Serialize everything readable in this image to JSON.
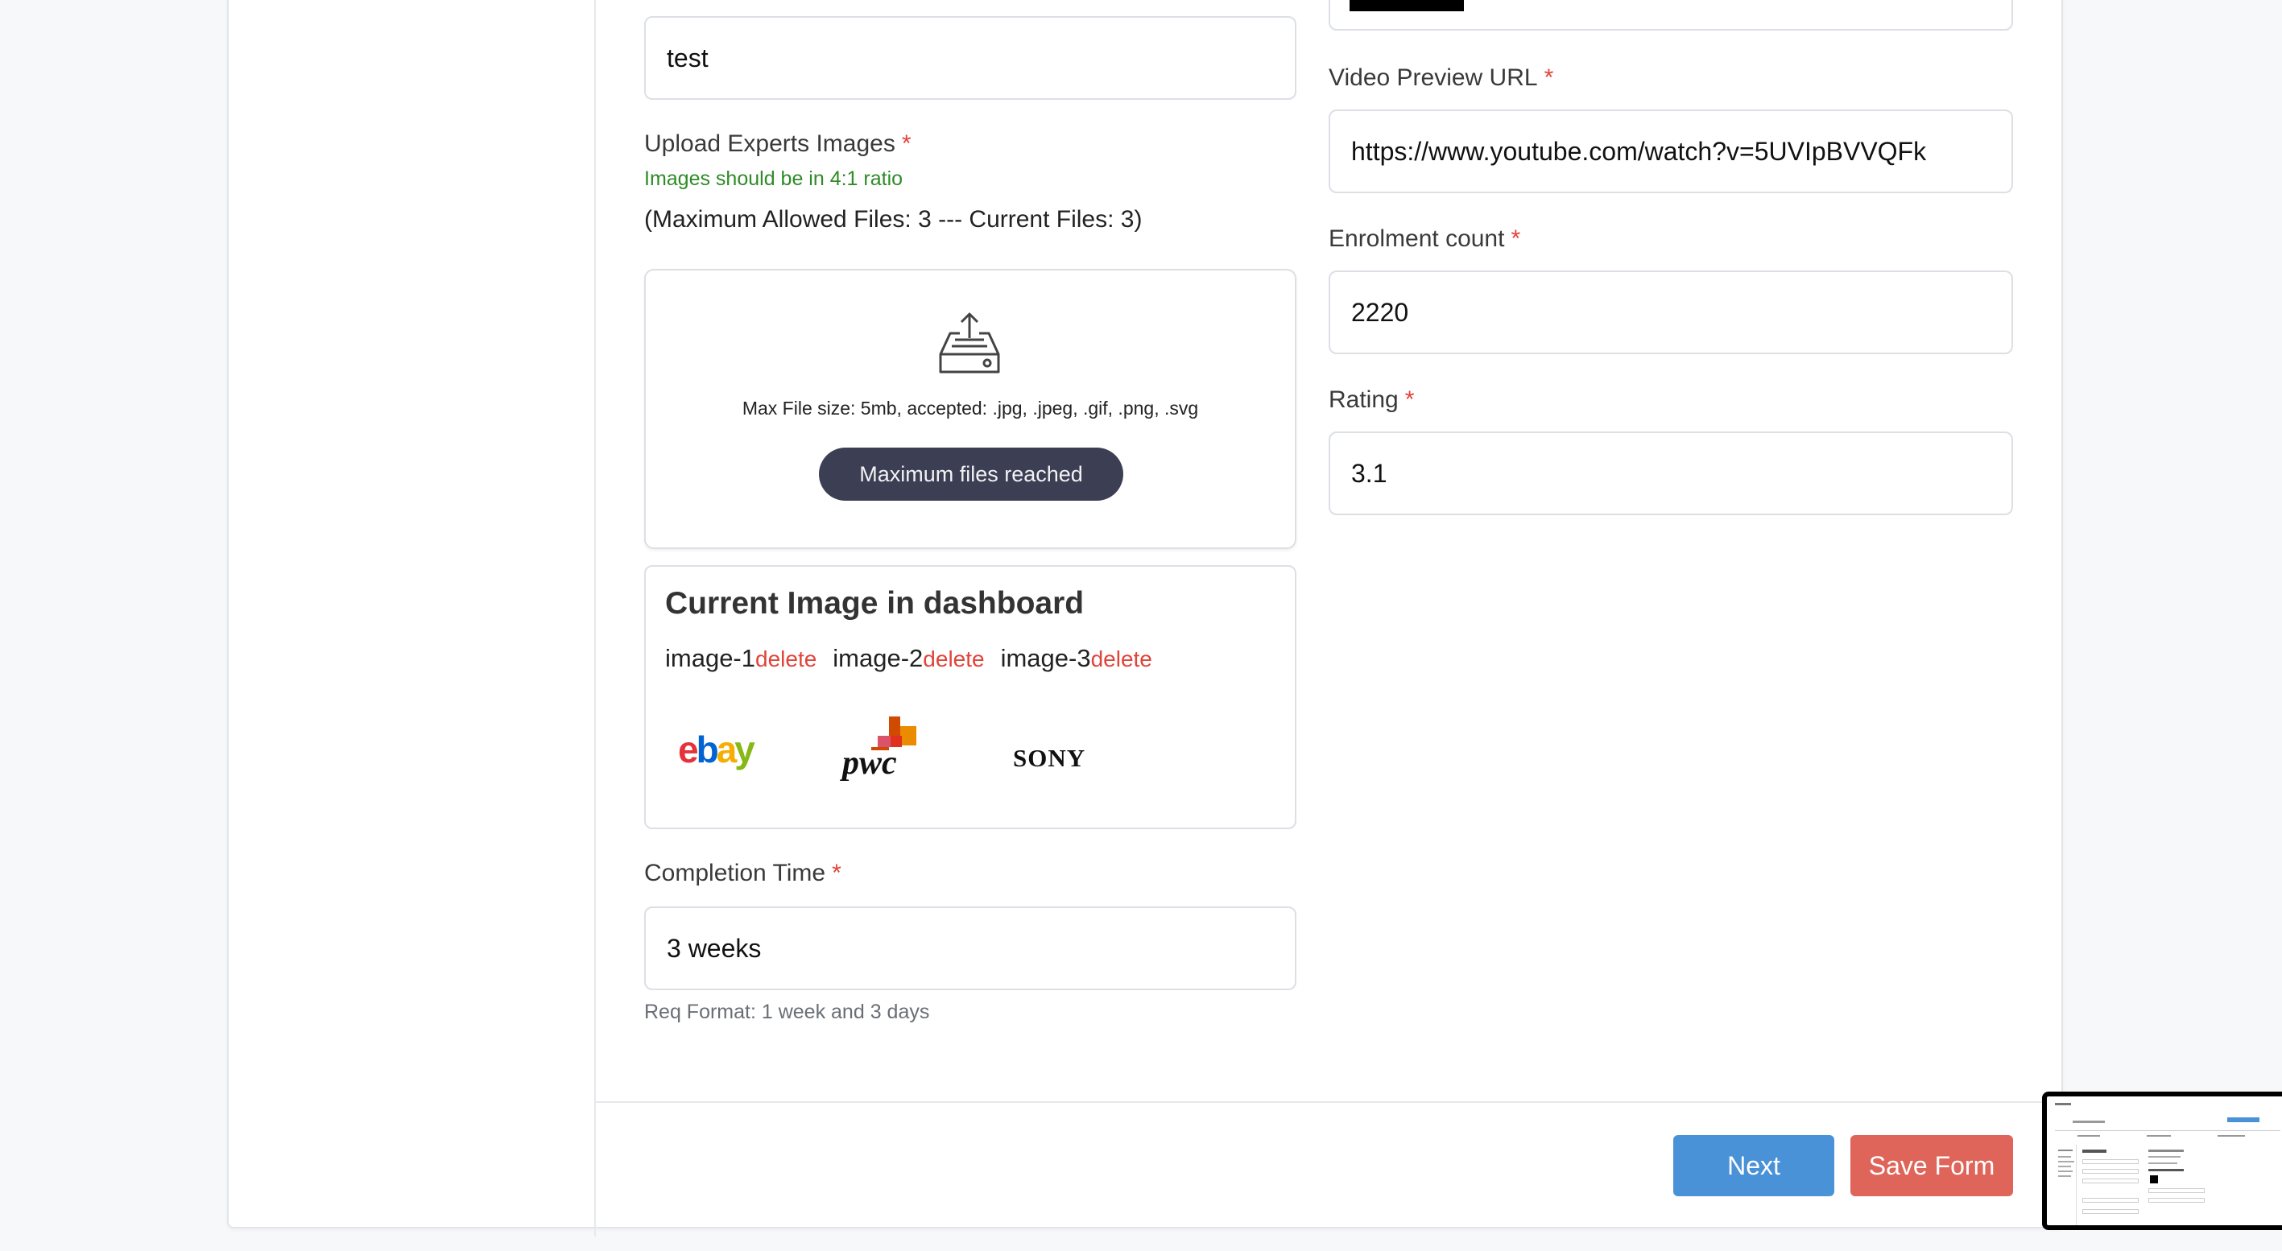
{
  "fields": {
    "top_left_value": "test",
    "upload": {
      "label": "Upload Experts Images",
      "required": "*",
      "ratio_hint": "Images should be in 4:1 ratio",
      "max_info": "(Maximum Allowed Files: 3 --- Current Files: 3)",
      "dropzone_text": "Max File size: 5mb, accepted: .jpg, .jpeg, .gif, .png, .svg",
      "dropzone_button": "Maximum files reached"
    },
    "current_images": {
      "title": "Current Image in dashboard",
      "items": [
        {
          "name": "image-1",
          "delete": "delete",
          "logo": "ebay"
        },
        {
          "name": "image-2",
          "delete": "delete",
          "logo": "pwc"
        },
        {
          "name": "image-3",
          "delete": "delete",
          "logo": "SONY"
        }
      ]
    },
    "completion_time": {
      "label": "Completion Time",
      "required": "*",
      "value": "3 weeks",
      "hint": "Req Format: 1 week and 3 days"
    },
    "video_preview": {
      "label": "Video Preview URL",
      "required": "*",
      "value": "https://www.youtube.com/watch?v=5UVIpBVVQFk"
    },
    "enrolment": {
      "label": "Enrolment count",
      "required": "*",
      "value": "2220"
    },
    "rating": {
      "label": "Rating",
      "required": "*",
      "value": "3.1"
    }
  },
  "footer": {
    "next": "Next",
    "save": "Save Form"
  },
  "colors": {
    "required": "#e0443a",
    "next": "#4a92d8",
    "save": "#df6459",
    "hint_green": "#2e8b27"
  }
}
